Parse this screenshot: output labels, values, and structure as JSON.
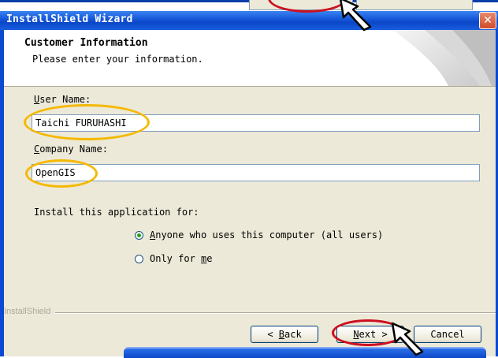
{
  "window": {
    "title": "InstallShield Wizard",
    "close_glyph": "✕"
  },
  "header": {
    "title": "Customer Information",
    "subtitle": "Please enter your information."
  },
  "form": {
    "user_name": {
      "label_mnemonic": "U",
      "label_rest": "ser Name:",
      "value": "Taichi FURUHASHI"
    },
    "company_name": {
      "label_mnemonic": "C",
      "label_rest": "ompany Name:",
      "value": "OpenGIS"
    },
    "install_for_label": "Install this application for:",
    "options": [
      {
        "mnemonic": "A",
        "rest": "nyone who uses this computer (all users)",
        "selected": true
      },
      {
        "prefix": "Only for ",
        "mnemonic": "m",
        "rest": "e",
        "selected": false
      }
    ]
  },
  "footer": {
    "brand": "InstallShield",
    "back": {
      "prefix": "< ",
      "mnemonic": "B",
      "rest": "ack"
    },
    "next": {
      "mnemonic": "N",
      "rest": "ext >"
    },
    "cancel": "Cancel"
  },
  "colors": {
    "titlebar": "#0a46c8",
    "annotation_yellow": "#f5b800",
    "annotation_red": "#cc1020"
  }
}
